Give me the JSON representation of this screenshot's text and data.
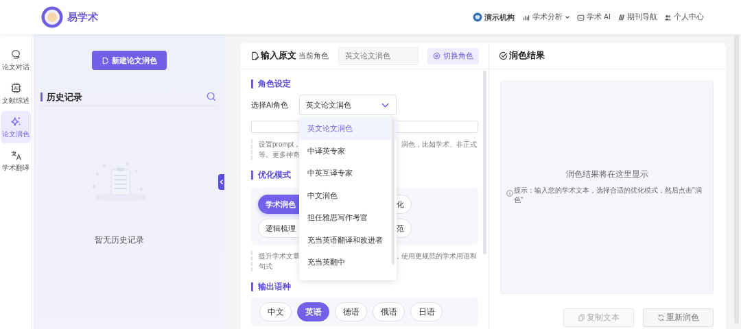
{
  "header": {
    "brand": "易学术",
    "nav": [
      {
        "kind": "org",
        "label": "演示机构"
      },
      {
        "kind": "menu",
        "label": "学术分析"
      },
      {
        "kind": "link",
        "label": "学术 AI"
      },
      {
        "kind": "link",
        "label": "期刊导航"
      },
      {
        "kind": "link",
        "label": "个人中心"
      }
    ]
  },
  "rail": [
    {
      "label": "论文对话",
      "selected": false
    },
    {
      "label": "文献综述",
      "selected": false
    },
    {
      "label": "论文润色",
      "selected": true
    },
    {
      "label": "学术翻译",
      "selected": false
    }
  ],
  "history": {
    "new_button": "新建论文润色",
    "title": "历史记录",
    "empty_text": "暂无历史记录"
  },
  "editor": {
    "title": "输入原文",
    "role_label": "当前角色",
    "role_value": "英文论文润色",
    "switch_button": "切换角色",
    "role_section": {
      "title": "角色设定",
      "select_label": "选择AI角色",
      "select_value": "英文论文润色",
      "hint_left": [
        "设置prompt，",
        "等。更多神奇"
      ],
      "hint_right": "润色，比如学术、非正式"
    },
    "dropdown": [
      {
        "label": "英文论文润色",
        "selected": true
      },
      {
        "label": "中译英专家",
        "selected": false
      },
      {
        "label": "中英互译专家",
        "selected": false
      },
      {
        "label": "中文润色",
        "selected": false
      },
      {
        "label": "担任雅思写作考官",
        "selected": false
      },
      {
        "label": "充当英语翻译和改进者",
        "selected": false
      },
      {
        "label": "充当英翻中",
        "selected": false
      }
    ],
    "mode_section": {
      "title": "优化模式",
      "chips": [
        {
          "label": "学术润色",
          "selected": true
        },
        {
          "label": "化",
          "selected": false
        },
        {
          "label": "逻辑梳理",
          "selected": false
        },
        {
          "label": "范",
          "selected": false
        }
      ],
      "hint_left": [
        "提升学术文章",
        "句式"
      ],
      "hint_right": "，使用更规范的学术用语和"
    },
    "language_section": {
      "title": "输出语种",
      "chips": [
        {
          "label": "中文",
          "selected": false
        },
        {
          "label": "英语",
          "selected": true
        },
        {
          "label": "德语",
          "selected": false
        },
        {
          "label": "俄语",
          "selected": false
        },
        {
          "label": "日语",
          "selected": false
        }
      ]
    }
  },
  "result": {
    "title": "润色结果",
    "placeholder": "润色结果将在这里显示",
    "tip": "提示：输入您的学术文本，选择合适的优化模式，然后点击\"润色\"",
    "buttons": [
      "复制文本",
      "重新润色"
    ]
  }
}
